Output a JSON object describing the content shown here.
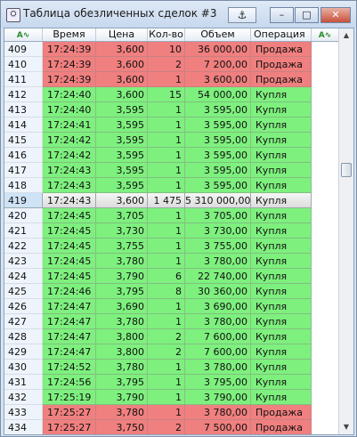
{
  "window": {
    "title": "Таблица обезличенных сделок #3",
    "anchor_label": "⚓",
    "minimize_label": "–",
    "maximize_label": "□",
    "close_label": "✕"
  },
  "table": {
    "columns": [
      "",
      "Время",
      "Цена",
      "Кол-во",
      "Объем",
      "Операция"
    ],
    "rows": [
      {
        "n": "409",
        "time": "17:24:39",
        "price": "3,600",
        "qty": "10",
        "vol": "36 000,00",
        "op": "Продажа",
        "side": "sell"
      },
      {
        "n": "410",
        "time": "17:24:39",
        "price": "3,600",
        "qty": "2",
        "vol": "7 200,00",
        "op": "Продажа",
        "side": "sell"
      },
      {
        "n": "411",
        "time": "17:24:39",
        "price": "3,600",
        "qty": "1",
        "vol": "3 600,00",
        "op": "Продажа",
        "side": "sell"
      },
      {
        "n": "412",
        "time": "17:24:40",
        "price": "3,600",
        "qty": "15",
        "vol": "54 000,00",
        "op": "Купля",
        "side": "buy"
      },
      {
        "n": "413",
        "time": "17:24:40",
        "price": "3,595",
        "qty": "1",
        "vol": "3 595,00",
        "op": "Купля",
        "side": "buy"
      },
      {
        "n": "414",
        "time": "17:24:41",
        "price": "3,595",
        "qty": "1",
        "vol": "3 595,00",
        "op": "Купля",
        "side": "buy"
      },
      {
        "n": "415",
        "time": "17:24:42",
        "price": "3,595",
        "qty": "1",
        "vol": "3 595,00",
        "op": "Купля",
        "side": "buy"
      },
      {
        "n": "416",
        "time": "17:24:42",
        "price": "3,595",
        "qty": "1",
        "vol": "3 595,00",
        "op": "Купля",
        "side": "buy"
      },
      {
        "n": "417",
        "time": "17:24:43",
        "price": "3,595",
        "qty": "1",
        "vol": "3 595,00",
        "op": "Купля",
        "side": "buy"
      },
      {
        "n": "418",
        "time": "17:24:43",
        "price": "3,595",
        "qty": "1",
        "vol": "3 595,00",
        "op": "Купля",
        "side": "buy"
      },
      {
        "n": "419",
        "time": "17:24:43",
        "price": "3,600",
        "qty": "1 475",
        "vol": "5 310 000,00",
        "op": "Купля",
        "side": "buy",
        "selected": true
      },
      {
        "n": "420",
        "time": "17:24:45",
        "price": "3,705",
        "qty": "1",
        "vol": "3 705,00",
        "op": "Купля",
        "side": "buy"
      },
      {
        "n": "421",
        "time": "17:24:45",
        "price": "3,730",
        "qty": "1",
        "vol": "3 730,00",
        "op": "Купля",
        "side": "buy"
      },
      {
        "n": "422",
        "time": "17:24:45",
        "price": "3,755",
        "qty": "1",
        "vol": "3 755,00",
        "op": "Купля",
        "side": "buy"
      },
      {
        "n": "423",
        "time": "17:24:45",
        "price": "3,780",
        "qty": "1",
        "vol": "3 780,00",
        "op": "Купля",
        "side": "buy"
      },
      {
        "n": "424",
        "time": "17:24:45",
        "price": "3,790",
        "qty": "6",
        "vol": "22 740,00",
        "op": "Купля",
        "side": "buy"
      },
      {
        "n": "425",
        "time": "17:24:46",
        "price": "3,795",
        "qty": "8",
        "vol": "30 360,00",
        "op": "Купля",
        "side": "buy"
      },
      {
        "n": "426",
        "time": "17:24:47",
        "price": "3,690",
        "qty": "1",
        "vol": "3 690,00",
        "op": "Купля",
        "side": "buy"
      },
      {
        "n": "427",
        "time": "17:24:47",
        "price": "3,780",
        "qty": "1",
        "vol": "3 780,00",
        "op": "Купля",
        "side": "buy"
      },
      {
        "n": "428",
        "time": "17:24:47",
        "price": "3,800",
        "qty": "2",
        "vol": "7 600,00",
        "op": "Купля",
        "side": "buy"
      },
      {
        "n": "429",
        "time": "17:24:47",
        "price": "3,800",
        "qty": "2",
        "vol": "7 600,00",
        "op": "Купля",
        "side": "buy"
      },
      {
        "n": "430",
        "time": "17:24:52",
        "price": "3,780",
        "qty": "1",
        "vol": "3 780,00",
        "op": "Купля",
        "side": "buy"
      },
      {
        "n": "431",
        "time": "17:24:56",
        "price": "3,795",
        "qty": "1",
        "vol": "3 795,00",
        "op": "Купля",
        "side": "buy"
      },
      {
        "n": "432",
        "time": "17:25:19",
        "price": "3,790",
        "qty": "1",
        "vol": "3 790,00",
        "op": "Купля",
        "side": "buy"
      },
      {
        "n": "433",
        "time": "17:25:27",
        "price": "3,780",
        "qty": "1",
        "vol": "3 780,00",
        "op": "Продажа",
        "side": "sell"
      },
      {
        "n": "434",
        "time": "17:25:27",
        "price": "3,750",
        "qty": "2",
        "vol": "7 500,00",
        "op": "Продажа",
        "side": "sell"
      }
    ]
  },
  "colors": {
    "buy": "#7ef07e",
    "sell": "#f07f7f",
    "selected": "#e6e6e6"
  }
}
